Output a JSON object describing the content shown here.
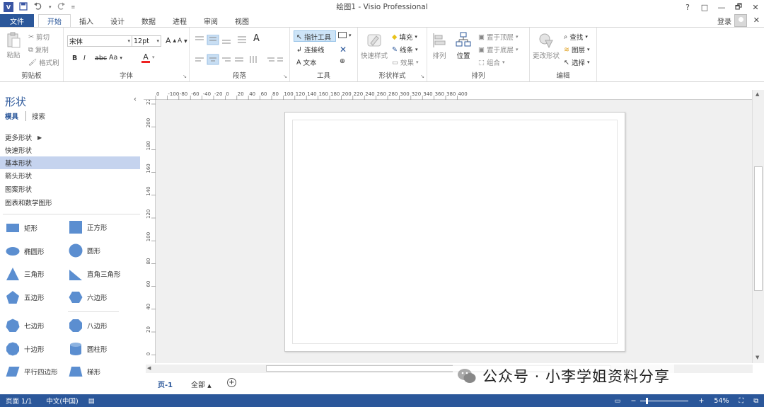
{
  "window": {
    "title": "绘图1 - Visio Professional",
    "app_badge": "V",
    "controls": [
      "?",
      "□",
      "🗗",
      "✕"
    ]
  },
  "tabs": {
    "file": "文件",
    "items": [
      "开始",
      "插入",
      "设计",
      "数据",
      "进程",
      "审阅",
      "视图"
    ],
    "active": "开始"
  },
  "account": {
    "signin": "登录"
  },
  "ribbon": {
    "clipboard": {
      "label": "剪贴板",
      "paste": "粘贴",
      "cut": "剪切",
      "copy": "复制",
      "format_painter": "格式刷"
    },
    "font": {
      "label": "字体",
      "family": "宋体",
      "size": "12pt",
      "bold": "B",
      "italic": "I",
      "strike": "abc",
      "case": "Aa",
      "color": "A",
      "grow": "A",
      "shrink": "A"
    },
    "paragraph": {
      "label": "段落"
    },
    "tools": {
      "label": "工具",
      "pointer": "指针工具",
      "connector": "连接线",
      "text": "文本"
    },
    "shape_styles": {
      "label": "形状样式",
      "quick_styles": "快速样式",
      "fill": "填充",
      "line": "线条",
      "effects": "效果"
    },
    "arrange": {
      "label": "排列",
      "align": "排列",
      "position": "位置",
      "bring_front": "置于顶层",
      "send_back": "置于底层",
      "group": "组合"
    },
    "editing": {
      "label": "编辑",
      "change_shape": "更改形状",
      "find": "查找",
      "layers": "图层",
      "select": "选择"
    }
  },
  "shapes_pane": {
    "title": "形状",
    "tab_stencils": "模具",
    "tab_search": "搜索",
    "stencils": [
      "更多形状",
      "快速形状",
      "基本形状",
      "箭头形状",
      "图案形状",
      "图表和数学图形"
    ],
    "selected_stencil": "基本形状",
    "shapes": [
      [
        "矩形",
        "正方形"
      ],
      [
        "椭圆形",
        "圆形"
      ],
      [
        "三角形",
        "直角三角形"
      ],
      [
        "五边形",
        "六边形"
      ],
      [
        "七边形",
        "八边形"
      ],
      [
        "十边形",
        "圆柱形"
      ],
      [
        "平行四边形",
        "梯形"
      ]
    ],
    "shape_color": "#5b8ed0"
  },
  "ruler": {
    "h_ticks": [
      "0",
      "-100",
      "-80",
      "-60",
      "-40",
      "-20",
      "0",
      "20",
      "40",
      "60",
      "80",
      "100",
      "120",
      "140",
      "160",
      "180",
      "200",
      "220",
      "240",
      "260",
      "280",
      "300",
      "320",
      "340",
      "360",
      "380",
      "400"
    ],
    "v_ticks": [
      "220",
      "200",
      "180",
      "160",
      "140",
      "120",
      "100",
      "80",
      "60",
      "40",
      "20",
      "0"
    ]
  },
  "page_tabs": {
    "current": "页-1",
    "all": "全部"
  },
  "watermark": "公众号 · 小李学姐资料分享",
  "status": {
    "page": "页面 1/1",
    "language": "中文(中国)",
    "zoom": "54%"
  }
}
